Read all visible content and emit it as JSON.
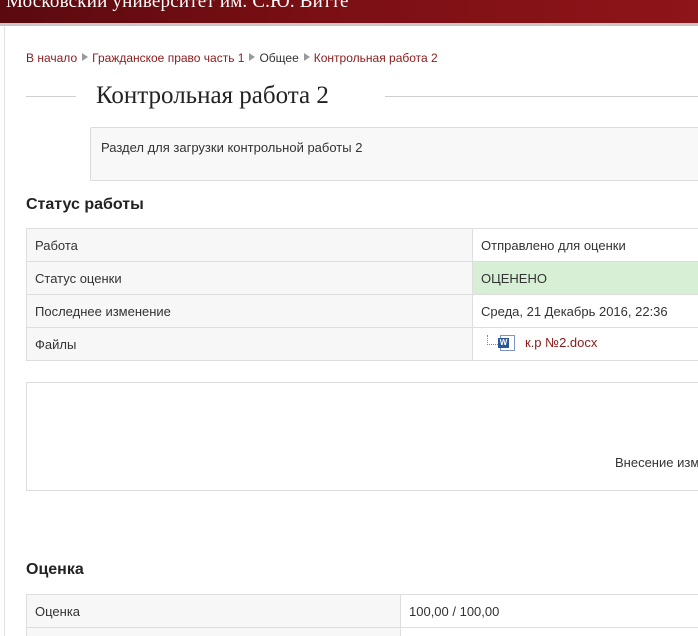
{
  "header": {
    "site_title": "Московский университет им. С.Ю. Витте"
  },
  "breadcrumb": {
    "items": [
      {
        "label": "В начало"
      },
      {
        "label": "Гражданское право часть 1"
      },
      {
        "label": "Общее"
      },
      {
        "label": "Контрольная работа 2"
      }
    ]
  },
  "page": {
    "title": "Контрольная работа 2",
    "intro": "Раздел для загрузки контрольной работы 2"
  },
  "submission_status": {
    "title": "Статус работы",
    "rows": [
      {
        "label": "Работа",
        "value": "Отправлено для оценки"
      },
      {
        "label": "Статус оценки",
        "value": "ОЦЕНЕНО"
      },
      {
        "label": "Последнее изменение",
        "value": "Среда, 21 Декабрь 2016, 22:36"
      },
      {
        "label": "Файлы",
        "value": "к.р №2.docx",
        "icon": "word-doc-icon"
      }
    ],
    "panel_text": "Внесение изменений"
  },
  "grade": {
    "title": "Оценка",
    "rows": [
      {
        "label": "Оценка",
        "value": "100,00 / 100,00"
      },
      {
        "label": "",
        "value": ""
      }
    ]
  },
  "colors": {
    "header_bg": "#7a0f14",
    "link": "#8b1a1a",
    "graded_bg": "#d7efd5"
  }
}
